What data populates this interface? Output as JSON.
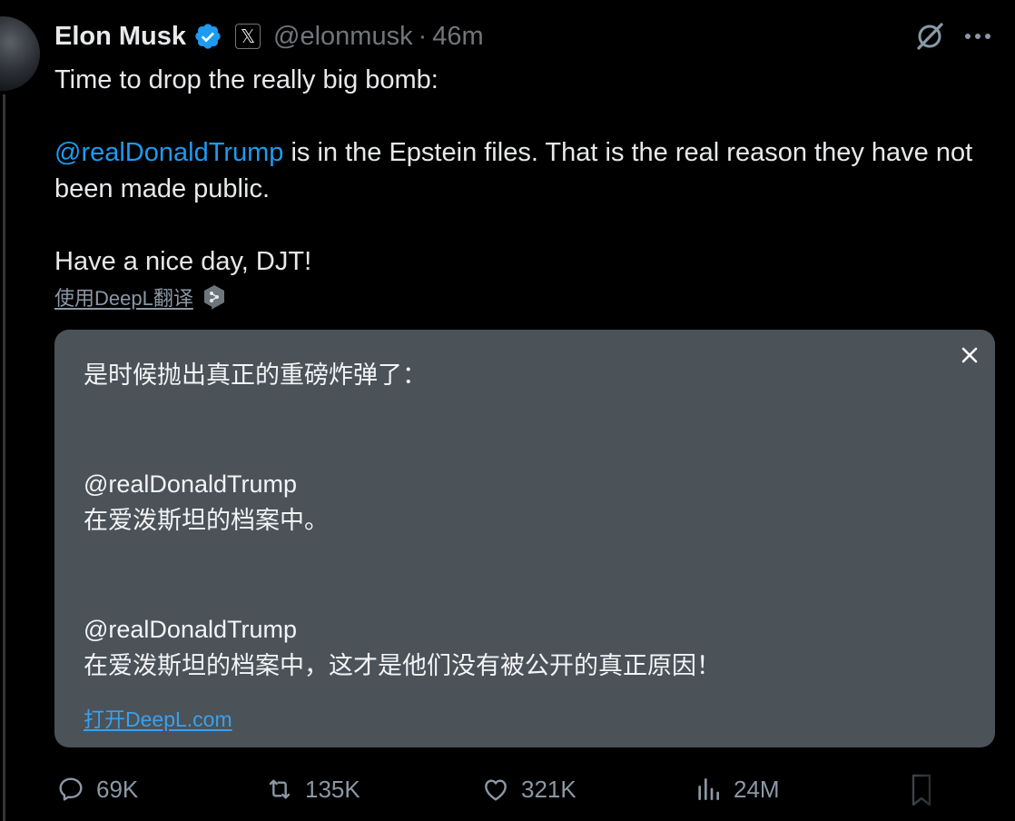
{
  "author": {
    "name": "Elon Musk",
    "handle": "@elonmusk",
    "separator": "·",
    "time": "46m",
    "x_badge": "𝕏"
  },
  "tweet": {
    "line1": "Time to drop the really big bomb:",
    "mention": "@realDonaldTrump",
    "line2_rest": " is in the Epstein files. That is the real reason they have not been made public.",
    "line3": "Have a nice day, DJT!"
  },
  "translate": {
    "link_label": "使用DeepL翻译"
  },
  "translation_box": {
    "para1": "是时候抛出真正的重磅炸弹了：",
    "para2_mention": "@realDonaldTrump",
    "para2_text": "在爱泼斯坦的档案中。",
    "para3_mention": "@realDonaldTrump",
    "para3_text": "在爱泼斯坦的档案中，这才是他们没有被公开的真正原因！",
    "open_link": "打开DeepL.com",
    "background_color": "#4b5258"
  },
  "actions": {
    "replies": "69K",
    "reposts": "135K",
    "likes": "321K",
    "views": "24M"
  },
  "colors": {
    "background": "#000000",
    "text": "#e7e9ea",
    "muted": "#71767b",
    "accent": "#1d9bf0",
    "verified": "#1d9bf0"
  },
  "icons": [
    "verified-badge-icon",
    "x-logo-icon",
    "grok-icon",
    "more-icon",
    "deepl-icon",
    "close-icon",
    "reply-icon",
    "repost-icon",
    "like-icon",
    "views-icon",
    "bookmark-icon"
  ]
}
